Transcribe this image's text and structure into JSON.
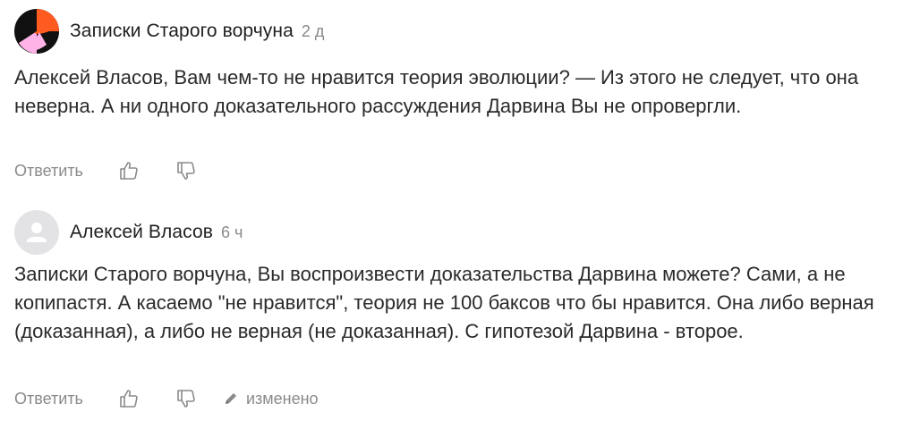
{
  "comments": [
    {
      "author": "Записки Старого ворчуна",
      "time": "2 д",
      "text": "Алексей Власов, Вам чем-то не нравится теория эволюции? — Из этого не следует, что она неверна. А ни одного доказательного рассуждения Дарвина Вы не опровергли.",
      "reply_label": "Ответить",
      "avatar": "orange-black-pink-logo",
      "like_icon": "thumbs-up-icon",
      "dislike_icon": "thumbs-down-icon"
    },
    {
      "author": "Алексей Власов",
      "time": "6 ч",
      "text": "Записки Старого ворчуна, Вы воспроизвести доказательства Дарвина можете? Сами, а не копипастя. А касаемо \"не нравится\", теория не 100 баксов что бы нравится. Она либо верная (доказанная), а либо не верная (не доказанная). С гипотезой Дарвина - второе.",
      "reply_label": "Ответить",
      "edited_label": "изменено",
      "avatar": "default-user-avatar",
      "like_icon": "thumbs-up-icon",
      "dislike_icon": "thumbs-down-icon",
      "edited_icon": "pencil-icon"
    }
  ],
  "colors": {
    "text": "#2a2a2a",
    "muted": "#8a8a8a",
    "avatar_orange": "#ff5a1f",
    "avatar_pink": "#ffb3e6",
    "avatar_gray_bg": "#e3e3e6",
    "avatar_gray_fg": "#ffffff"
  }
}
